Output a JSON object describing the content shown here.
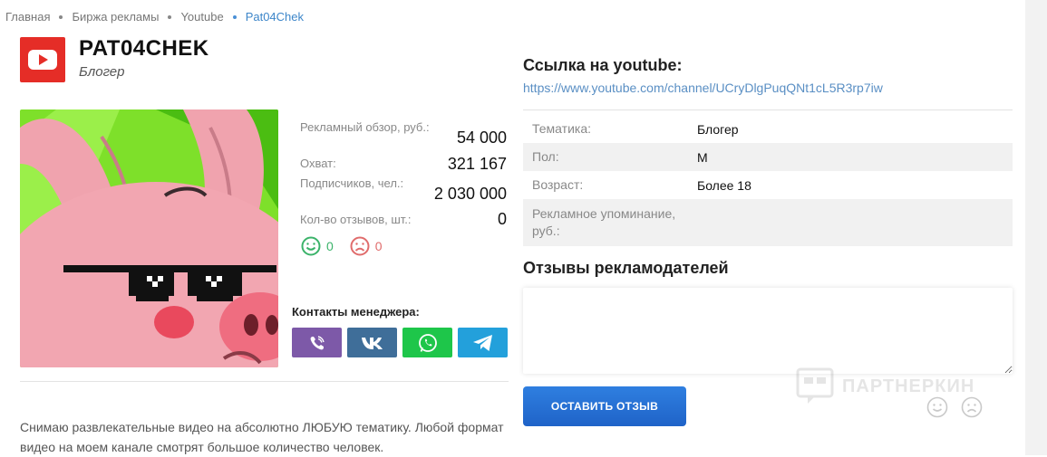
{
  "breadcrumb": {
    "items": [
      "Главная",
      "Биржа рекламы",
      "Youtube"
    ],
    "current": "Pat04Chek"
  },
  "channel": {
    "name": "PAT04CHEK",
    "type": "Блогер",
    "platform_icon": "youtube-icon"
  },
  "stats": [
    {
      "label": "Рекламный обзор, руб.:",
      "value": "54 000"
    },
    {
      "label": "Охват:",
      "value": "321 167"
    },
    {
      "label": "Подписчиков, чел.:",
      "value": "2 030 000"
    },
    {
      "label": "Кол-во отзывов, шт.:",
      "value": "0"
    }
  ],
  "reactions": {
    "positive": "0",
    "negative": "0"
  },
  "contacts": {
    "title": "Контакты менеджера:",
    "buttons": [
      "viber-icon",
      "vk-icon",
      "whatsapp-icon",
      "telegram-icon"
    ]
  },
  "description": "Снимаю развлекательные видео на абсолютно ЛЮБУЮ тематику. Любой формат видео на моем канале смотрят большое количество человек.",
  "link": {
    "title": "Ссылка на youtube:",
    "url": "https://www.youtube.com/channel/UCryDlgPuqQNt1cL5R3rp7iw"
  },
  "info": [
    {
      "label": "Тематика:",
      "value": "Блогер"
    },
    {
      "label": "Пол:",
      "value": "М"
    },
    {
      "label": "Возраст:",
      "value": "Более 18"
    },
    {
      "label": "Рекламное упоминание, руб.:",
      "value": ""
    }
  ],
  "reviews": {
    "title": "Отзывы рекламодателей",
    "submit_label": "ОСТАВИТЬ ОТЗЫВ",
    "placeholder": ""
  },
  "watermark": "ПАРТНЕРКИН",
  "colors": {
    "accent": "#2f7fe0",
    "youtube": "#e52d27",
    "positive": "#3bb36a",
    "negative": "#e06c6c",
    "link": "#5a8fc4"
  }
}
